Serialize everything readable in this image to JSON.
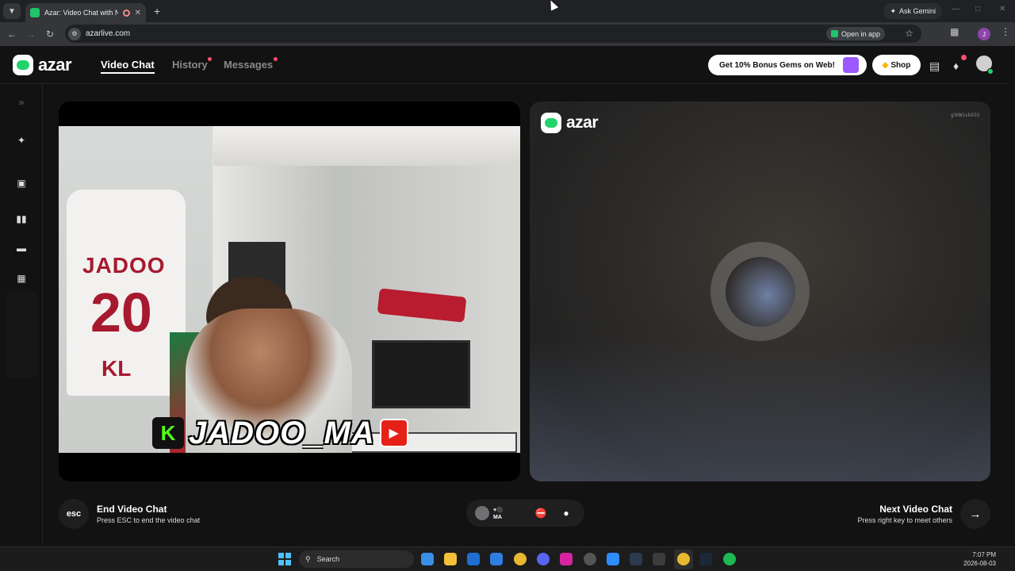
{
  "browser": {
    "tab_title": "Azar: Video Chat with New",
    "new_tab_icon": "plus-icon",
    "ask_gemini_label": "Ask Gemini",
    "url": "azarlive.com",
    "open_in_app_label": "Open in app",
    "profile_initial": "J"
  },
  "header": {
    "logo_text": "azar",
    "nav": {
      "video_chat": "Video Chat",
      "history": "History",
      "messages": "Messages"
    },
    "promo_label": "Get 10% Bonus Gems on Web!",
    "shop_label": "Shop",
    "accent_color": "#22d36b",
    "notification_color": "#ff4d6a"
  },
  "local_video": {
    "jersey_name": "JADOO",
    "jersey_number": "20",
    "jersey_letters": "KL",
    "overlay_text": "JADOO_MA",
    "kick_letter": "K"
  },
  "remote_video": {
    "watermark_logo": "azar",
    "peer_id": "g3HWisk0IU"
  },
  "controls": {
    "esc_label": "esc",
    "end_title": "End Video Chat",
    "end_subtitle": "Press ESC to end the video chat",
    "peer_country_code": "MA",
    "next_title": "Next Video Chat",
    "next_subtitle": "Press right key to meet others"
  },
  "taskbar": {
    "search_placeholder": "Search",
    "time": "7:07 PM",
    "date": "2026-08-03"
  }
}
